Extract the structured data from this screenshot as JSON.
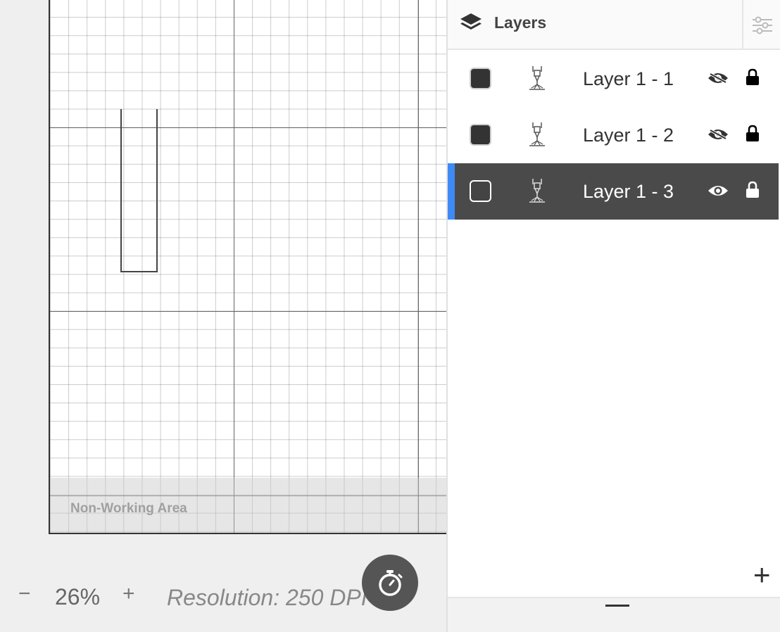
{
  "canvas": {
    "non_working_area_label": "Non-Working Area"
  },
  "zoom": {
    "minus_label": "−",
    "value": "26%",
    "plus_label": "+",
    "resolution": "Resolution: 250 DPI"
  },
  "layers_panel": {
    "title": "Layers",
    "add_label": "+",
    "items": [
      {
        "name": "Layer 1 - 1",
        "color": "#333333",
        "visible": false,
        "locked": true,
        "selected": false
      },
      {
        "name": "Layer 1 - 2",
        "color": "#333333",
        "visible": false,
        "locked": true,
        "selected": false
      },
      {
        "name": "Layer 1 - 3",
        "color": "#444444",
        "visible": true,
        "locked": true,
        "selected": true
      }
    ]
  },
  "colors": {
    "accent": "#3d8af7",
    "selected_row": "#4a4a4a"
  }
}
